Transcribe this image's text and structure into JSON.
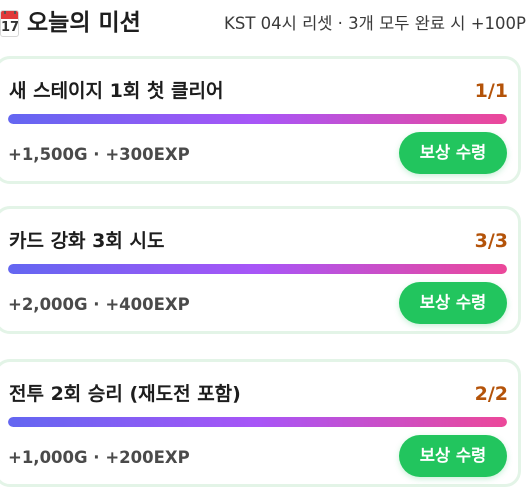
{
  "header": {
    "calendar_icon_day": "17",
    "title": "오늘의 미션",
    "subtitle": "KST 04시 리셋 · 3개 모두 완료 시 +100P"
  },
  "missions": [
    {
      "title": "새 스테이지 1회 첫 클리어",
      "progress": "1/1",
      "progress_fraction": 1.0,
      "reward": "+1,500G · +300EXP",
      "button_label": "보상 수령"
    },
    {
      "title": "카드 강화 3회 시도",
      "progress": "3/3",
      "progress_fraction": 1.0,
      "reward": "+2,000G · +400EXP",
      "button_label": "보상 수령"
    },
    {
      "title": "전투 2회 승리 (재도전 포함)",
      "progress": "2/2",
      "progress_fraction": 1.0,
      "reward": "+1,000G · +200EXP",
      "button_label": "보상 수령"
    }
  ],
  "colors": {
    "accent_button": "#22c55e",
    "progress_count": "#b45309",
    "progress_gradient": [
      "#6366f1",
      "#a855f7",
      "#ec4899"
    ],
    "card_border": "#e3f4e7"
  }
}
